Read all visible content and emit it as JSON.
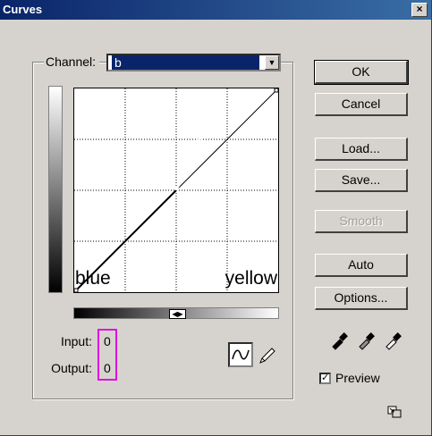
{
  "window": {
    "title": "Curves",
    "close_symbol": "×"
  },
  "channel": {
    "label": "Channel:",
    "value": "b"
  },
  "graph": {
    "left_label": "blue",
    "right_label": "yellow"
  },
  "readout": {
    "input_label": "Input:",
    "input_value": "0",
    "output_label": "Output:",
    "output_value": "0"
  },
  "buttons": {
    "ok": "OK",
    "cancel": "Cancel",
    "load": "Load...",
    "save": "Save...",
    "smooth": "Smooth",
    "auto": "Auto",
    "options": "Options..."
  },
  "preview": {
    "label": "Preview",
    "checked": true
  },
  "icons": {
    "curve_tool": "curve-tool-icon",
    "pencil_tool": "pencil-icon",
    "droppers": [
      "black-eyedropper-icon",
      "gray-eyedropper-icon",
      "white-eyedropper-icon"
    ],
    "resize": "resize-icon"
  },
  "colors": {
    "titlebar": "#0a246a",
    "selection": "#0a246a",
    "highlight_box": "#e010e0",
    "dialog_bg": "#d6d3ce"
  }
}
